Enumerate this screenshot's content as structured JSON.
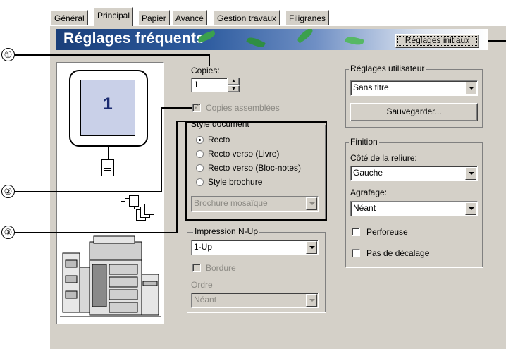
{
  "tabs": [
    "Général",
    "Principal",
    "Papier",
    "Avancé",
    "Gestion travaux",
    "Filigranes"
  ],
  "active_tab": "Principal",
  "banner": {
    "title": "Réglages fréquents",
    "initial_button": "Réglages initiaux"
  },
  "preview": {
    "page_number": "1"
  },
  "copies": {
    "label": "Copies:",
    "value": "1"
  },
  "collate": {
    "label": "Copies assemblées",
    "checked": true,
    "disabled": true
  },
  "document_style": {
    "title": "Style document",
    "options": [
      "Recto",
      "Recto verso (Livre)",
      "Recto verso (Bloc-notes)",
      "Style brochure"
    ],
    "selected": "Recto",
    "brochure_select": "Brochure mosaïque"
  },
  "nup": {
    "title": "Impression N-Up",
    "value": "1-Up",
    "border_label": "Bordure",
    "order_label": "Ordre",
    "order_value": "Néant"
  },
  "user_settings": {
    "title": "Réglages utilisateur",
    "value": "Sans titre",
    "save_button": "Sauvegarder..."
  },
  "finishing": {
    "title": "Finition",
    "binding_label": "Côté de la reliure:",
    "binding_value": "Gauche",
    "staple_label": "Agrafage:",
    "staple_value": "Néant",
    "punch_label": "Perforeuse",
    "no_offset_label": "Pas de décalage"
  },
  "callouts": [
    "①",
    "②",
    "③"
  ]
}
